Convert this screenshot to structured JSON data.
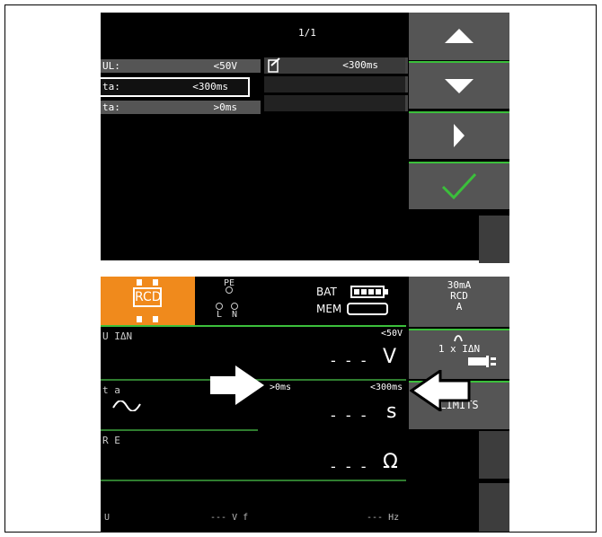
{
  "top": {
    "page_indicator": "1/1",
    "limits": [
      {
        "name": "UL:",
        "value": "<50V"
      },
      {
        "name": "ta:",
        "value": "<300ms"
      },
      {
        "name": "ta:",
        "value": ">0ms"
      }
    ],
    "right_rows": {
      "head_value": "<300ms"
    },
    "buttons": [
      "up-icon",
      "down-icon",
      "right-icon",
      "check-icon"
    ]
  },
  "bottom": {
    "badge": "RCD",
    "terminals": {
      "pe": "PE",
      "l": "L",
      "n": "N"
    },
    "bat_label": "BAT",
    "mem_label": "MEM",
    "rows": [
      {
        "label": "U IΔN",
        "limit": "<50V",
        "dashes": "- - -",
        "unit": "V"
      },
      {
        "label": "t a",
        "limit_low": ">0ms",
        "limit": "<300ms",
        "dashes": "- - -",
        "unit": "s"
      },
      {
        "label": "R E",
        "dashes": "- - -",
        "unit": "Ω"
      }
    ],
    "side": {
      "current": "30mA",
      "type": "RCD",
      "class": "A",
      "mode": "1 x IΔN",
      "limits": "LIMITS"
    },
    "footer": {
      "u": "U",
      "vf": "--- V f",
      "hz": "--- Hz"
    }
  },
  "colors": {
    "accent_green": "#3bbf3b",
    "badge_orange": "#f08a1c"
  }
}
